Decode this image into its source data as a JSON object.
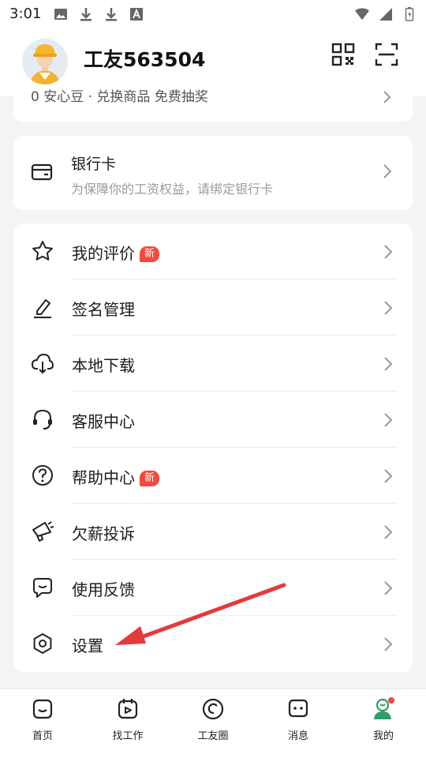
{
  "status_bar": {
    "time": "3:01",
    "left_icons": [
      "image-icon",
      "download-icon",
      "download-icon",
      "font-icon"
    ],
    "right_icons": [
      "wifi-icon",
      "signal-icon",
      "battery-icon"
    ]
  },
  "header": {
    "username": "工友563504",
    "avatar_icon": "worker-avatar-icon",
    "qr_icon": "qr-code-icon",
    "scan_icon": "scan-icon"
  },
  "top_card": {
    "peek_text": "0 安心豆 · 兑换商品 免费抽奖"
  },
  "bank_card": {
    "title": "银行卡",
    "subtitle": "为保障你的工资权益，请绑定银行卡",
    "icon": "bank-card-icon"
  },
  "menu": {
    "items": [
      {
        "label": "我的评价",
        "badge": "新",
        "icon": "star-icon"
      },
      {
        "label": "签名管理",
        "badge": "",
        "icon": "pen-icon"
      },
      {
        "label": "本地下载",
        "badge": "",
        "icon": "cloud-download-icon"
      },
      {
        "label": "客服中心",
        "badge": "",
        "icon": "headset-icon"
      },
      {
        "label": "帮助中心",
        "badge": "新",
        "icon": "question-icon"
      },
      {
        "label": "欠薪投诉",
        "badge": "",
        "icon": "megaphone-icon"
      },
      {
        "label": "使用反馈",
        "badge": "",
        "icon": "feedback-icon"
      },
      {
        "label": "设置",
        "badge": "",
        "icon": "settings-icon"
      }
    ]
  },
  "bottom_nav": {
    "items": [
      {
        "label": "首页",
        "icon": "home-icon"
      },
      {
        "label": "找工作",
        "icon": "find-job-icon"
      },
      {
        "label": "工友圈",
        "icon": "circle-icon"
      },
      {
        "label": "消息",
        "icon": "message-icon"
      },
      {
        "label": "我的",
        "icon": "profile-icon",
        "active": true
      }
    ]
  },
  "colors": {
    "background": "#f4f4f5",
    "card": "#ffffff",
    "badge": "#f04a3e",
    "accent_green": "#2e9e6b",
    "annotation_arrow": "#e03c3c"
  }
}
